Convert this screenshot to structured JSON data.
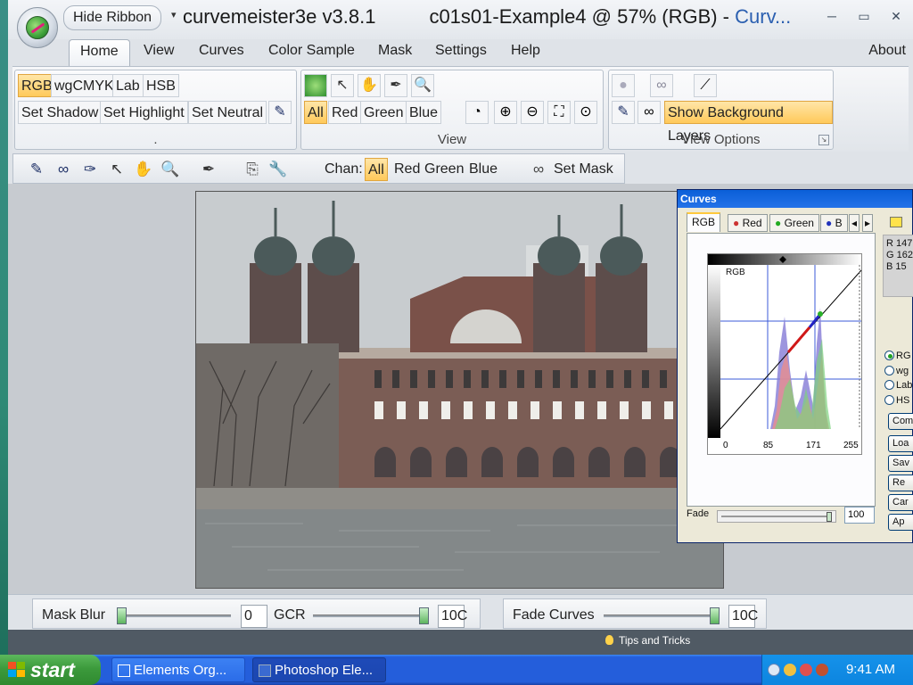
{
  "app": {
    "hide_ribbon_label": "Hide Ribbon",
    "title_app": "curvemeister3e v3.8.1",
    "title_doc": "c01s01-Example4 @ 57% (RGB) - ",
    "title_panel": "Curv...",
    "minimize_glyph": "─",
    "maximize_glyph": "▭",
    "close_glyph": "✕",
    "qa_glyph": "▾"
  },
  "menu": {
    "tabs": [
      "Home",
      "View",
      "Curves",
      "Color Sample",
      "Mask",
      "Settings",
      "Help"
    ],
    "active": "Home",
    "about": "About"
  },
  "ribbon": {
    "colorspace_buttons": [
      "RGB",
      "wgCMYK",
      "Lab",
      "HSB"
    ],
    "colorspace_selected": "RGB",
    "set_buttons": [
      "Set Shadow",
      "Set Highlight",
      "Set Neutral"
    ],
    "group1_label": ".",
    "channel_buttons": [
      "All",
      "Red",
      "Green",
      "Blue"
    ],
    "channel_selected": "All",
    "view_label": "View",
    "show_background": "Show Background Layers",
    "view_options_label": "View Options"
  },
  "toolbar": {
    "chan_label": "Chan:",
    "channels": [
      "All",
      "Red",
      "Green",
      "Blue"
    ],
    "channel_selected": "All",
    "set_mask": "Set Mask"
  },
  "bottom": {
    "mask_blur_label": "Mask Blur",
    "mask_blur_value": "0",
    "gcr_label": "GCR",
    "gcr_value": "10C",
    "fade_curves_label": "Fade Curves",
    "fade_curves_value": "10C"
  },
  "status": {
    "tips": "Tips and Tricks"
  },
  "curves_dialog": {
    "title": "Curves",
    "tabs": [
      "RGB",
      "Red",
      "Green",
      "B"
    ],
    "tab_selected": "RGB",
    "graph_label": "RGB",
    "axis_ticks": [
      "0",
      "85",
      "171",
      "255"
    ],
    "readout": {
      "r": "R  147",
      "g": "G  162",
      "b": "B  15"
    },
    "modes": [
      "RG",
      "wg",
      "Lab",
      "HS"
    ],
    "mode_selected": "RG",
    "buttons": [
      "Com",
      "Loa",
      "Sav",
      "Re",
      "Car",
      "Ap"
    ],
    "fade_label": "Fade",
    "fade_value": "100"
  },
  "taskbar": {
    "start": "start",
    "tasks": [
      "Elements Org...",
      "Photoshop Ele..."
    ],
    "active_task": "Photoshop Ele...",
    "clock": "9:41 AM"
  },
  "colors": {
    "ribbon_selected": "#ffc95a",
    "title_panel": "#2b5fb0",
    "taskbar": "#245edb",
    "start_green": "#3c9a3c"
  }
}
